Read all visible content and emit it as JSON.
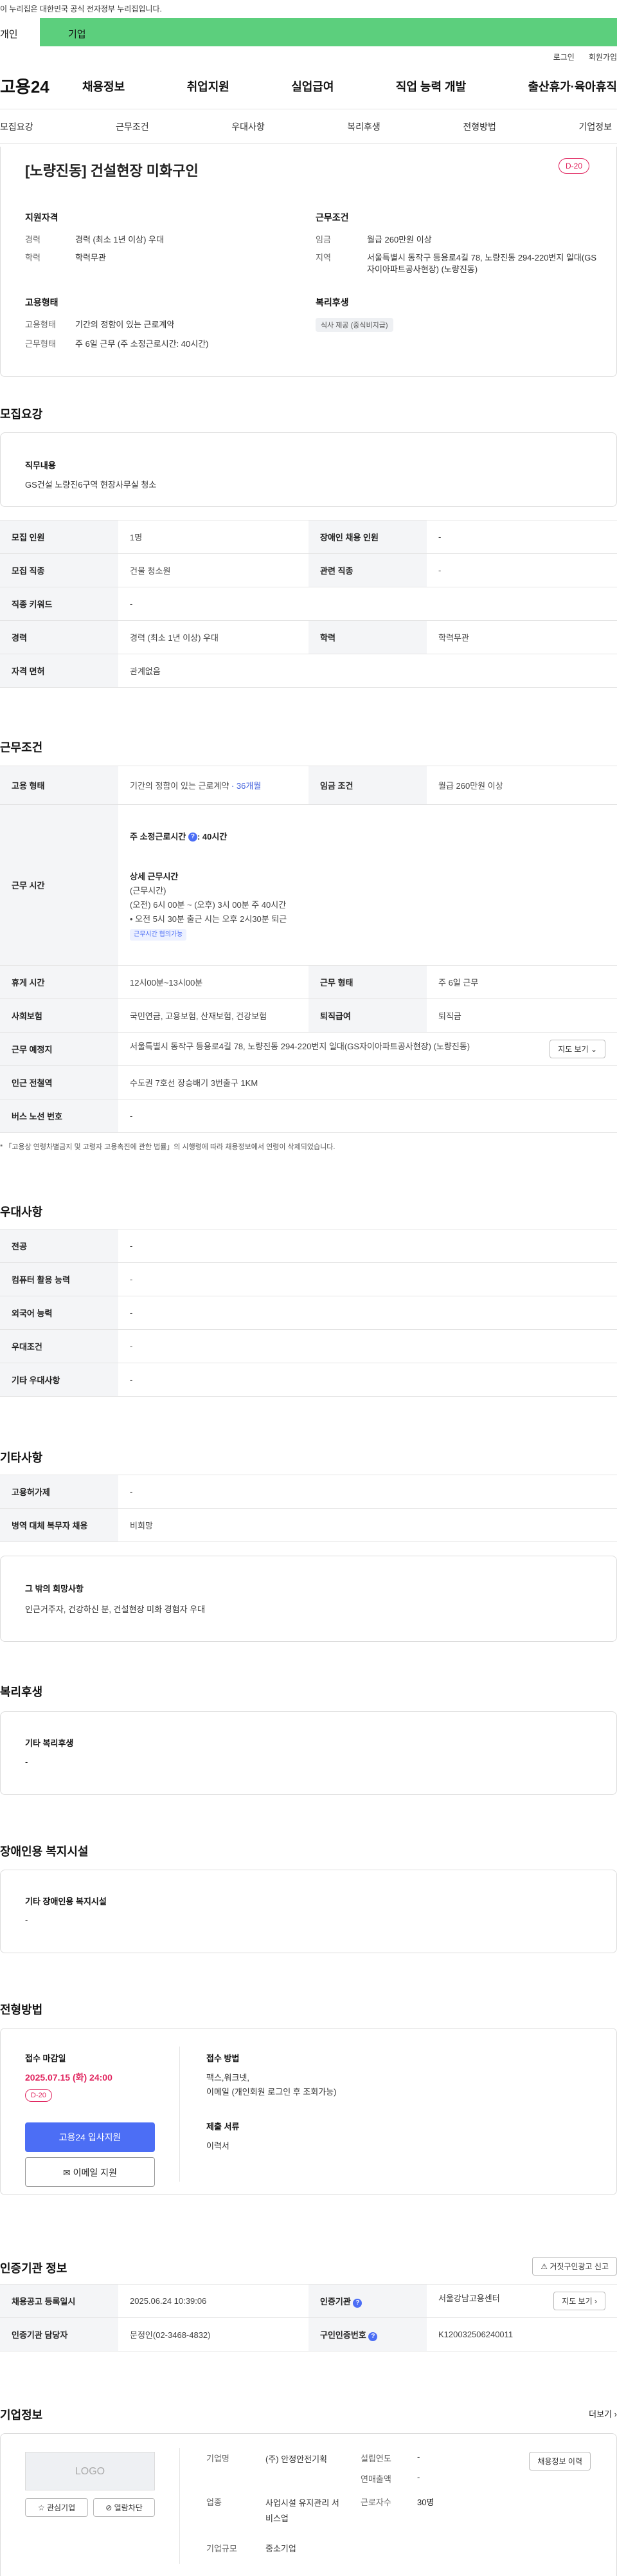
{
  "notice": "이 누리집은 대한민국 공식 전자정부 누리집입니다.",
  "usertype": {
    "individual": "개인",
    "enterprise": "기업"
  },
  "util": {
    "login": "로그인",
    "join": "회원가입"
  },
  "brand": "고용24",
  "gnb": [
    "채용정보",
    "취업지원",
    "실업급여",
    "직업 능력 개발",
    "출산휴가·육아휴직"
  ],
  "tabs": [
    "모집요강",
    "근무조건",
    "우대사항",
    "복리후생",
    "전형방법",
    "기업정보"
  ],
  "job": {
    "title": "[노량진동] 건설현장 미화구인",
    "dday": "D-20",
    "qual_title": "지원자격",
    "career_k": "경력",
    "career_v": "경력 (최소 1년 이상) 우대",
    "edu_k": "학력",
    "edu_v": "학력무관",
    "emp_title": "고용형태",
    "emptype_k": "고용형태",
    "emptype_v": "기간의 정함이 있는 근로계약",
    "worktype_k": "근무형태",
    "worktype_v": "주 6일 근무 (주 소정근로시간: 40시간)",
    "cond_title": "근무조건",
    "wage_k": "임금",
    "wage_v": "월급 260만원 이상",
    "area_k": "지역",
    "area_v": "서울특별시 동작구 등용로4길 78, 노량진동 294-220번지 일대(GS자이아파트공사현장) (노량진동)",
    "welfare_title": "복리후생",
    "welfare_tag": "식사 제공 (중식비지급)"
  },
  "recruit": {
    "heading": "모집요강",
    "duty_title": "직무내용",
    "duty_text": "GS건설 노량진6구역 현장사무실 청소",
    "rows": [
      [
        "모집 인원",
        "1명",
        "장애인 채용 인원",
        "-"
      ],
      [
        "모집 직종",
        "건물 청소원",
        "관련 직종",
        "-"
      ],
      [
        "직종 키워드",
        "-"
      ],
      [
        "경력",
        "경력 (최소 1년 이상) 우대",
        "학력",
        "학력무관"
      ],
      [
        "자격 면허",
        "관계없음"
      ]
    ]
  },
  "work": {
    "heading": "근무조건",
    "emp_k": "고용 형태",
    "emp_v": "기간의 정함이 있는 근로계약",
    "emp_extra": "· 36개월",
    "wage_k": "임금 조건",
    "wage_v": "월급 260만원 이상",
    "time_k": "근무 시간",
    "time_week": "주 소정근로시간",
    "time_week_v": ": 40시간",
    "time_detail_title": "상세 근무시간",
    "time_lines": [
      "(근무시간)",
      "(오전) 6시 00분 ~ (오후) 3시 00분 주 40시간",
      "• 오전 5시 30분 출근 시는 오후 2시30분 퇴근"
    ],
    "time_flex": "근무시간 협의가능",
    "break_k": "휴게 시간",
    "break_v": "12시00분~13시00분",
    "shift_k": "근무 형태",
    "shift_v": "주 6일 근무",
    "ins_k": "사회보험",
    "ins_v": "국민연금, 고용보험, 산재보험, 건강보험",
    "retire_k": "퇴직급여",
    "retire_v": "퇴직금",
    "place_k": "근무 예정지",
    "place_v": "서울특별시 동작구 등용로4길 78, 노량진동 294-220번지 일대(GS자이아파트공사현장) (노량진동)",
    "map_btn": "지도 보기",
    "station_k": "인근 전철역",
    "station_v": "수도권 7호선 장승배기 3번출구 1KM",
    "bus_k": "버스 노선 번호",
    "bus_v": "-",
    "note": "* 「고용상 연령차별금지 및 고령자 고용촉진에 관한 법률」의 시행령에 따라 채용정보에서 연령이 삭제되었습니다."
  },
  "pref": {
    "heading": "우대사항",
    "rows": [
      [
        "전공",
        "-"
      ],
      [
        "컴퓨터 활용 능력",
        "-"
      ],
      [
        "외국어 능력",
        "-"
      ],
      [
        "우대조건",
        "-"
      ],
      [
        "기타 우대사항",
        "-"
      ]
    ]
  },
  "etc": {
    "heading": "기타사항",
    "rows": [
      [
        "고용허가제",
        "-"
      ],
      [
        "병역 대체 복무자 채용",
        "비희망"
      ]
    ],
    "other_title": "그 밖의 희망사항",
    "other_text": "인근거주자, 건강하신 분, 건설현장 미화 경험자 우대"
  },
  "welfare": {
    "heading": "복리후생",
    "sub": "기타 복리후생",
    "val": "-"
  },
  "disabled": {
    "heading": "장애인용 복지시설",
    "sub": "기타 장애인용 복지시설",
    "val": "-"
  },
  "selection": {
    "heading": "전형방법",
    "deadline_title": "접수 마감일",
    "deadline": "2025.07.15 (화) 24:00",
    "dday": "D-20",
    "apply_btn": "고용24 입사지원",
    "email_btn": "이메일 지원",
    "method_title": "접수 방법",
    "method_lines": [
      "팩스,워크넷,",
      "이메일 (개인회원 로그인 후 조회가능)"
    ],
    "docs_title": "제출 서류",
    "docs": "이력서"
  },
  "agency": {
    "heading": "인증기관 정보",
    "report_btn": "거짓구인광고 신고",
    "reg_k": "채용공고 등록일시",
    "reg_v": "2025.06.24 10:39:06",
    "org_k": "인증기관",
    "org_v": "서울강남고용센터",
    "map_btn": "지도 보기",
    "mgr_k": "인증기관 담당자",
    "mgr_v": "문정인(02-3468-4832)",
    "no_k": "구인인증번호",
    "no_v": "K120032506240011"
  },
  "company": {
    "heading": "기업정보",
    "more": "더보기",
    "logo": "LOGO",
    "fav_btn": "관심기업",
    "block_btn": "열람차단",
    "name_k": "기업명",
    "name_v": "(주) 안정안전기획",
    "found_k": "설립연도",
    "found_v": "-",
    "sales_k": "연매출액",
    "sales_v": "-",
    "ind_k": "업종",
    "ind_v": "사업시설 유지관리 서비스업",
    "emp_k": "근로자수",
    "emp_v": "30명",
    "size_k": "기업규모",
    "size_v": "중소기업",
    "info_btn": "채용정보 이력"
  }
}
